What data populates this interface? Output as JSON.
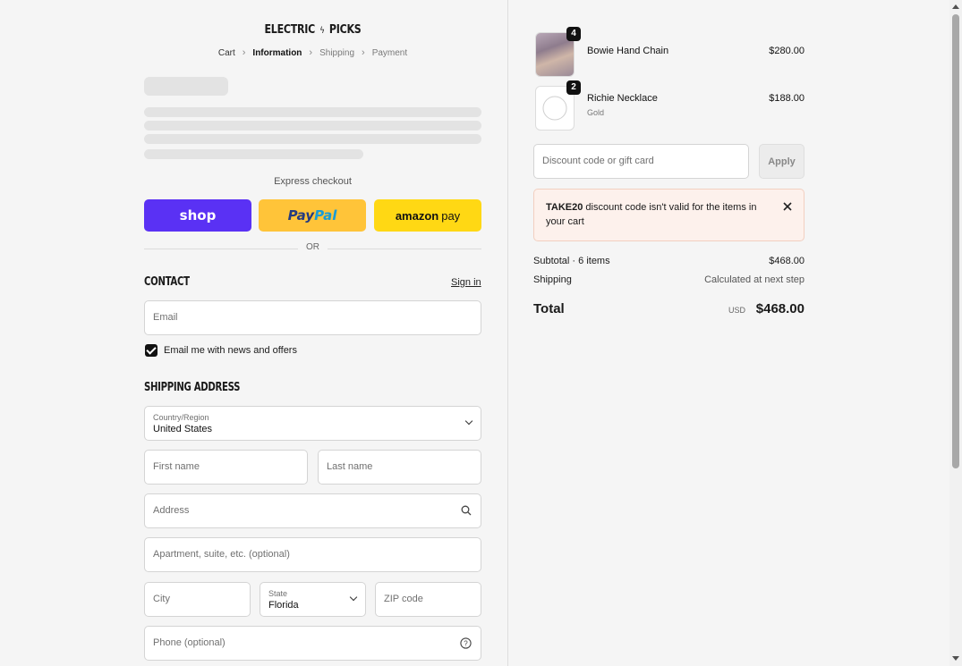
{
  "brand": {
    "logo_left": "ELECTRIC",
    "logo_right": "PICKS"
  },
  "breadcrumb": {
    "cart": "Cart",
    "information": "Information",
    "shipping": "Shipping",
    "payment": "Payment"
  },
  "express": {
    "label": "Express checkout",
    "shop_label": "shop",
    "paypal_label_1": "Pay",
    "paypal_label_2": "Pal",
    "amazon_label": "amazon",
    "amazon_pay": "pay",
    "or": "OR"
  },
  "contact": {
    "title": "Contact",
    "sign_in": "Sign in",
    "email_placeholder": "Email",
    "newsletter_label": "Email me with news and offers",
    "newsletter_checked": true
  },
  "shipping": {
    "title": "Shipping address",
    "country_label": "Country/Region",
    "country_value": "United States",
    "first_name_placeholder": "First name",
    "last_name_placeholder": "Last name",
    "address_placeholder": "Address",
    "apartment_placeholder": "Apartment, suite, etc. (optional)",
    "city_placeholder": "City",
    "state_label": "State",
    "state_value": "Florida",
    "zip_placeholder": "ZIP code",
    "phone_placeholder": "Phone (optional)"
  },
  "cart": {
    "items": [
      {
        "name": "Bowie Hand Chain",
        "variant": "",
        "qty": "4",
        "price": "$280.00"
      },
      {
        "name": "Richie Necklace",
        "variant": "Gold",
        "qty": "2",
        "price": "$188.00"
      }
    ],
    "discount_placeholder": "Discount code or gift card",
    "apply_label": "Apply",
    "alert_code": "TAKE20",
    "alert_message": " discount code isn't valid for the items in your cart",
    "subtotal_label": "Subtotal · 6 items",
    "subtotal_value": "$468.00",
    "shipping_label": "Shipping",
    "shipping_value": "Calculated at next step",
    "total_label": "Total",
    "currency": "USD",
    "total_value": "$468.00"
  },
  "colors": {
    "shop_purple": "#5a31f4",
    "paypal_yellow": "#ffc439",
    "amazon_yellow": "#ffd814",
    "alert_bg": "#fdf1ec"
  }
}
